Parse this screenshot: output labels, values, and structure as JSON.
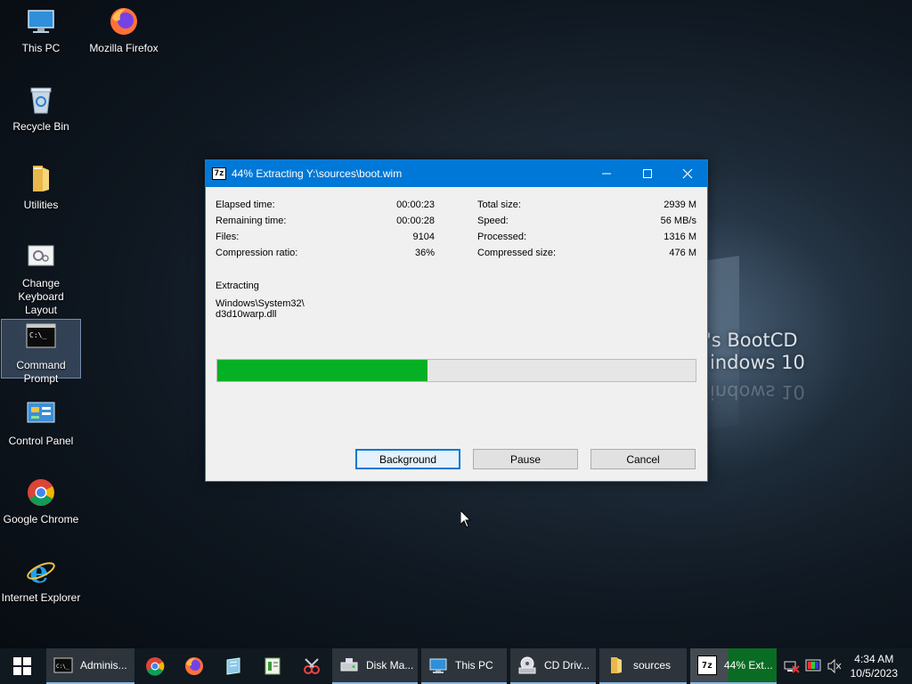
{
  "desktop": {
    "icons": [
      {
        "label": "This PC"
      },
      {
        "label": "Mozilla Firefox"
      },
      {
        "label": "Recycle Bin"
      },
      {
        "label": "Utilities"
      },
      {
        "label": "Change Keyboard Layout"
      },
      {
        "label": "Command Prompt"
      },
      {
        "label": "Control Panel"
      },
      {
        "label": "Google Chrome"
      },
      {
        "label": "Internet Explorer"
      }
    ],
    "wallpaper_line1": "'s BootCD",
    "wallpaper_line2": "indows 10",
    "wallpaper_reflect": "indows 10"
  },
  "window": {
    "app_icon": "7z",
    "title": "44% Extracting Y:\\sources\\boot.wim",
    "stats_left": [
      {
        "label": "Elapsed time:",
        "value": "00:00:23"
      },
      {
        "label": "Remaining time:",
        "value": "00:00:28"
      },
      {
        "label": "Files:",
        "value": "9104"
      },
      {
        "label": "Compression ratio:",
        "value": "36%"
      }
    ],
    "stats_right": [
      {
        "label": "Total size:",
        "value": "2939 M"
      },
      {
        "label": "Speed:",
        "value": "56 MB/s"
      },
      {
        "label": "Processed:",
        "value": "1316 M"
      },
      {
        "label": "Compressed size:",
        "value": "476 M"
      }
    ],
    "status": "Extracting",
    "current_file_line1": "Windows\\System32\\",
    "current_file_line2": "d3d10warp.dll",
    "progress_fraction": 0.44,
    "buttons": {
      "background": "Background",
      "pause": "Pause",
      "cancel": "Cancel"
    }
  },
  "taskbar": {
    "tasks": [
      {
        "label": "Adminis..."
      },
      {
        "label": "Disk Ma..."
      },
      {
        "label": "This PC"
      },
      {
        "label": "CD Driv..."
      },
      {
        "label": "sources"
      },
      {
        "label": "44% Ext..."
      }
    ],
    "active_task_icon": "7z",
    "time": "4:34 AM",
    "date": "10/5/2023"
  },
  "colors": {
    "accent": "#0078d7",
    "progress": "#06b025",
    "taskbar": "#101820"
  }
}
